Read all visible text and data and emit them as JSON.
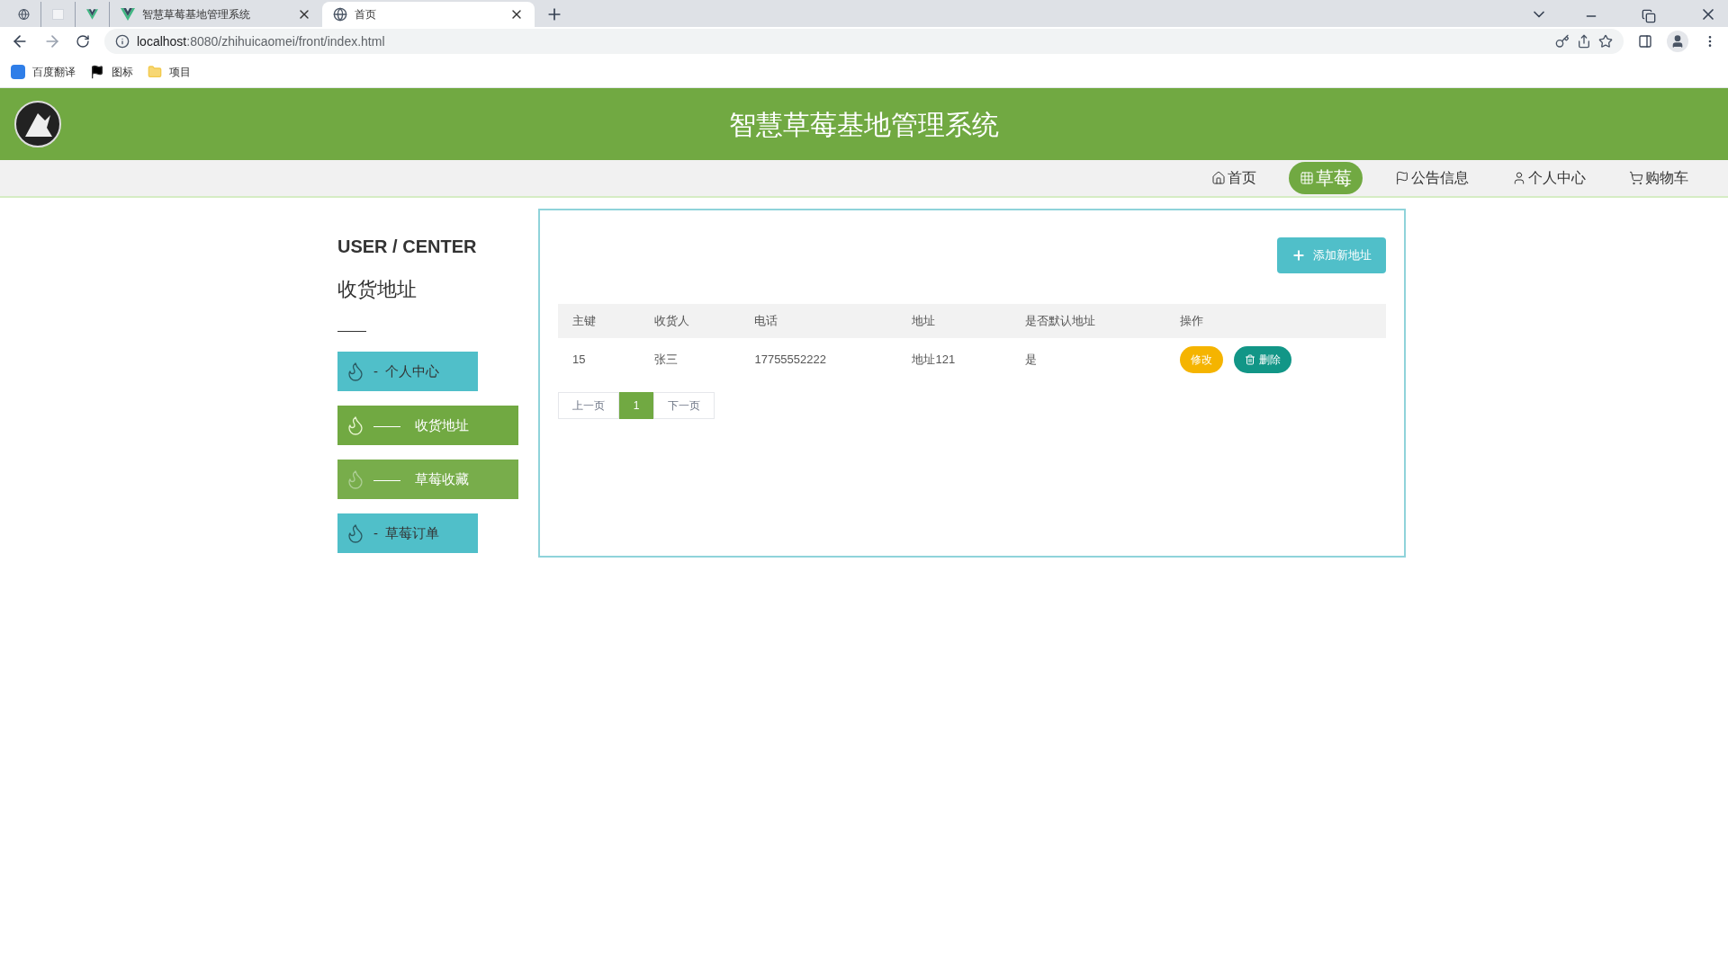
{
  "browser": {
    "tabs": [
      {
        "kind": "globe",
        "selected": false
      },
      {
        "kind": "blank",
        "selected": false
      },
      {
        "kind": "vue",
        "selected": false
      },
      {
        "kind": "vue",
        "title": "智慧草莓基地管理系统",
        "selected": false
      },
      {
        "kind": "globe",
        "title": "首页",
        "selected": true
      }
    ],
    "url_host": "localhost",
    "url_rest": ":8080/zhihuicaomei/front/index.html",
    "bookmarks": [
      {
        "kind": "translate",
        "label": "百度翻译"
      },
      {
        "kind": "flag",
        "label": "图标"
      },
      {
        "kind": "folder",
        "label": "项目"
      }
    ]
  },
  "header": {
    "title": "智慧草莓基地管理系统"
  },
  "nav": [
    {
      "kind": "home",
      "label": "首页",
      "selected": false
    },
    {
      "kind": "grid",
      "label": "草莓",
      "selected": true
    },
    {
      "kind": "flag",
      "label": "公告信息",
      "selected": false
    },
    {
      "kind": "user",
      "label": "个人中心",
      "selected": false
    },
    {
      "kind": "cart",
      "label": "购物车",
      "selected": false
    }
  ],
  "sidebar": {
    "heading": "USER / CENTER",
    "subtitle": "收货地址",
    "items": [
      {
        "prefix": "-",
        "label": "个人中心",
        "selected": false,
        "hovered": false
      },
      {
        "prefix": "——",
        "label": "收货地址",
        "selected": true,
        "hovered": false
      },
      {
        "prefix": "——",
        "label": "草莓收藏",
        "selected": false,
        "hovered": true
      },
      {
        "prefix": "-",
        "label": "草莓订单",
        "selected": false,
        "hovered": false
      }
    ]
  },
  "add_button": "添加新地址",
  "table": {
    "columns": [
      "主键",
      "收货人",
      "电话",
      "地址",
      "是否默认地址",
      "操作"
    ],
    "rows": [
      {
        "cells": [
          "15",
          "张三",
          "17755552222",
          "地址121",
          "是"
        ],
        "edit": "修改",
        "delete": "删除"
      }
    ]
  },
  "pagination": {
    "prev": "上一页",
    "pages": [
      {
        "label": "1",
        "selected": true
      }
    ],
    "next": "下一页"
  }
}
